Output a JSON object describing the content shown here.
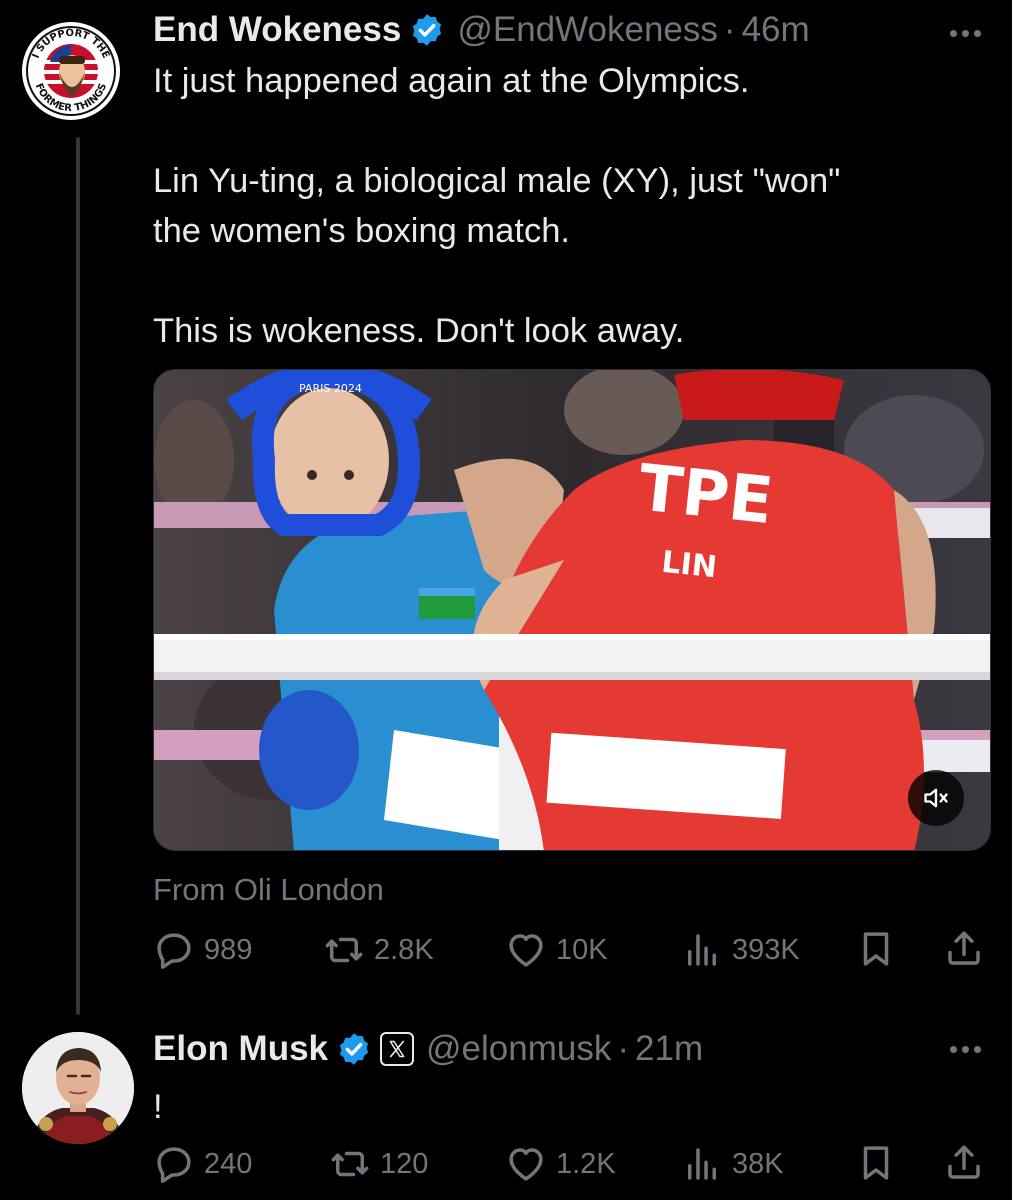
{
  "posts": [
    {
      "display_name": "End Wokeness",
      "handle": "@EndWokeness",
      "separator": "·",
      "time": "46m",
      "text": "It just happened again at the Olympics.\n\nLin Yu-ting, a biological male (XY), just \"won\"\nthe women's boxing match.\n\nThis is wokeness. Don't look away.",
      "avatar_text_top": "I SUPPORT THE",
      "avatar_text_bottom": "FORMER THINGS",
      "media": {
        "jersey_country": "TPE",
        "jersey_name": "LIN"
      },
      "source": "From Oli London",
      "stats": {
        "replies": "989",
        "reposts": "2.8K",
        "likes": "10K",
        "views": "393K"
      }
    },
    {
      "display_name": "Elon Musk",
      "handle": "@elonmusk",
      "separator": "·",
      "time": "21m",
      "text": "!",
      "stats": {
        "replies": "240",
        "reposts": "120",
        "likes": "1.2K",
        "views": "38K"
      }
    }
  ],
  "colors": {
    "background": "#000000",
    "text_primary": "#e7e9ea",
    "text_secondary": "#71767b",
    "verified_blue": "#1d9bf0",
    "thread_line": "#333639"
  },
  "icons": {
    "verified": "verified-badge-icon",
    "affiliate": "x-logo-icon",
    "more": "more-options-icon",
    "reply": "reply-icon",
    "repost": "repost-icon",
    "like": "heart-icon",
    "views": "views-icon",
    "bookmark": "bookmark-icon",
    "share": "share-icon",
    "mute": "mute-icon"
  }
}
